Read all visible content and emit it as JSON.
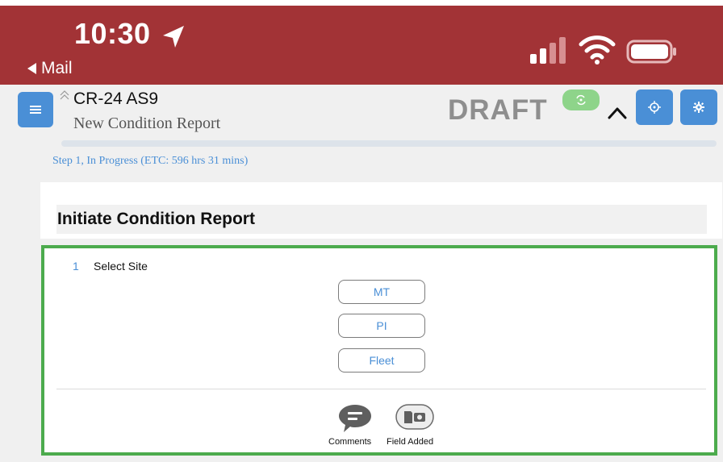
{
  "status_bar": {
    "time": "10:30",
    "back_label": "Mail",
    "bar_color": "#a23336"
  },
  "header": {
    "report_id": "CR-24 AS9",
    "report_title": "New Condition Report",
    "draft_label": "DRAFT",
    "menu_icon": "menu-icon",
    "target_icon": "target-icon",
    "gear_icon": "gear-icon",
    "accent": "#4a8fd6"
  },
  "step": {
    "text": "Step 1, In Progress (ETC: 596 hrs 31 mins)"
  },
  "section": {
    "title": "Initiate Condition Report"
  },
  "question": {
    "number": "1",
    "label": "Select Site",
    "options": [
      "MT",
      "PI",
      "Fleet"
    ],
    "selected_outline": "#4cab4d"
  },
  "actions": {
    "comments_label": "Comments",
    "field_added_label": "Field Added"
  }
}
